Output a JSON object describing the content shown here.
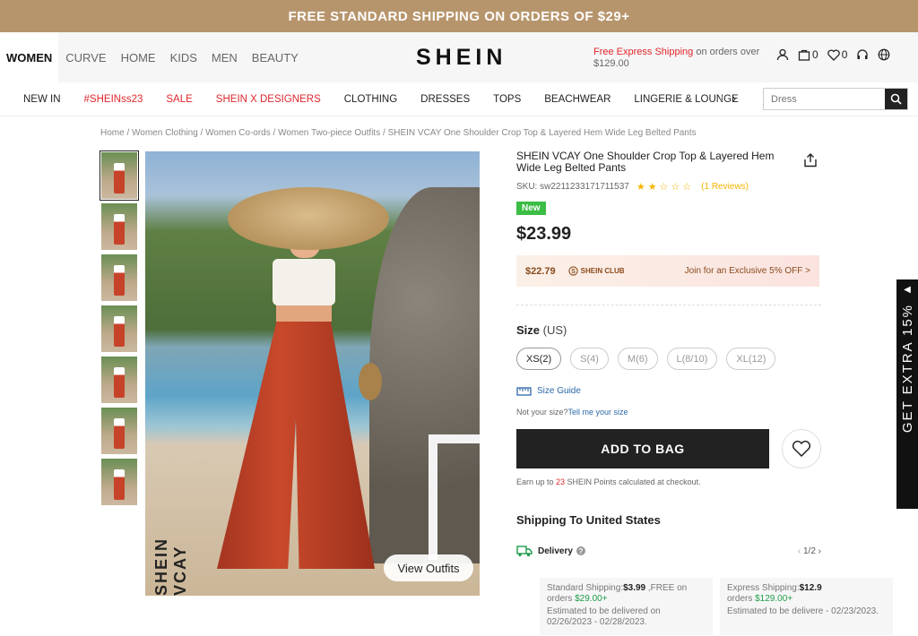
{
  "promo": {
    "text": "FREE STANDARD SHIPPING ON ORDERS OF $29+"
  },
  "header": {
    "tabs": [
      "WOMEN",
      "CURVE",
      "HOME",
      "KIDS",
      "MEN",
      "BEAUTY"
    ],
    "logo": "SHEIN",
    "free_express_red": "Free Express Shipping",
    "free_express_rest": " on orders over $129.00",
    "cart_count": "0",
    "wish_count": "0"
  },
  "nav": {
    "items": [
      "NEW IN",
      "#SHEINss23",
      "SALE",
      "SHEIN X DESIGNERS",
      "CLOTHING",
      "DRESSES",
      "TOPS",
      "BEACHWEAR",
      "LINGERIE & LOUNGE"
    ],
    "search_placeholder": "Dress"
  },
  "breadcrumb": [
    "Home",
    "Women Clothing",
    "Women Co-ords",
    "Women Two-piece Outfits",
    "SHEIN VCAY One Shoulder Crop Top & Layered Hem Wide Leg Belted Pants"
  ],
  "gallery": {
    "watermark": "SHEIN VCAY",
    "view_outfits": "View Outfits"
  },
  "product": {
    "title": "SHEIN VCAY One Shoulder Crop Top & Layered Hem Wide Leg Belted Pants",
    "sku": "SKU: sw2211233171711537",
    "rating": 2,
    "stars": "★★☆☆☆",
    "reviews": "(1 Reviews)",
    "badge": "New",
    "price": "$23.99",
    "club_price": "$22.79",
    "club_label": "SHEIN CLUB",
    "club_join": "Join for an Exclusive 5% OFF >",
    "size_title": "Size",
    "size_unit": "(US)",
    "sizes": [
      "XS(2)",
      "S(4)",
      "M(6)",
      "L(8/10)",
      "XL(12)"
    ],
    "size_guide": "Size Guide",
    "not_your_size": "Not your size?",
    "tell_me": "Tell me your size",
    "add_to_bag": "ADD TO BAG",
    "points_pre": "Earn up to ",
    "points_num": "23",
    "points_post": " SHEIN Points calculated at checkout."
  },
  "shipping": {
    "title": "Shipping To United States",
    "delivery": "Delivery",
    "pager": "1/2",
    "standard_pre": "Standard Shipping:",
    "standard_price": "$3.99",
    "standard_free": " ,FREE on orders ",
    "standard_min": "$29.00+",
    "standard_est": "Estimated to be delivered on 02/26/2023 - 02/28/2023.",
    "express_pre": "Express Shipping:",
    "express_price": "$12.9",
    "express_orders": "orders ",
    "express_min": "$129.00+",
    "express_est": "Estimated to be delivere - 02/23/2023."
  },
  "side_tab": {
    "text": "GET EXTRA 15%"
  }
}
